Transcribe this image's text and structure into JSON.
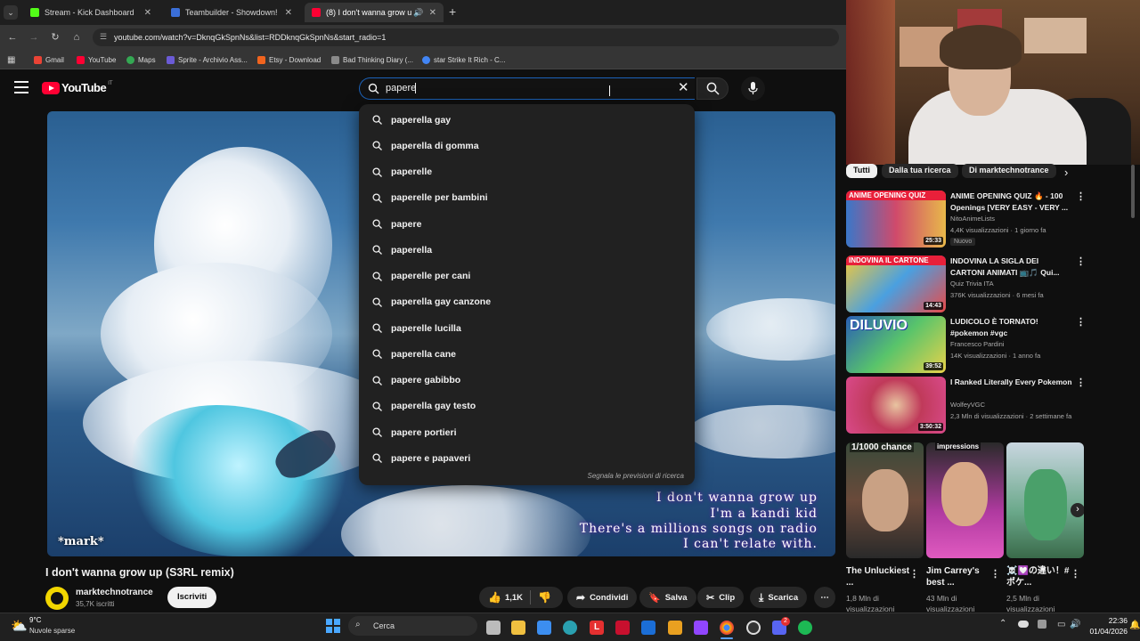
{
  "browser": {
    "tabs": [
      {
        "title": "Stream - Kick Dashboard",
        "favicon_color": "#53fc18",
        "active": false
      },
      {
        "title": "Teambuilder - Showdown!",
        "favicon_color": "#3b6fd8",
        "active": false
      },
      {
        "title": "(8) I don't wanna grow up (",
        "favicon_color": "#ff0033",
        "active": true
      }
    ],
    "new_tab_icon": "plus-icon",
    "url": "youtube.com/watch?v=DknqGkSpnNs&list=RDDknqGkSpnNs&start_radio=1",
    "bookmarks": [
      {
        "label": "Gmail",
        "color": "#ea4335"
      },
      {
        "label": "YouTube",
        "color": "#ff0033"
      },
      {
        "label": "Maps",
        "color": "#34a853"
      },
      {
        "label": "Sprite - Archivio Ass...",
        "color": "#6b5bd6"
      },
      {
        "label": "Etsy - Download",
        "color": "#f1641e"
      },
      {
        "label": "Bad Thinking Diary (...",
        "color": "#8a8a8a"
      },
      {
        "label": "star Strike It Rich - C...",
        "color": "#4285f4"
      }
    ]
  },
  "youtube": {
    "logo_text": "YouTube",
    "logo_region": "IT",
    "search_query": "papere",
    "suggestions": [
      "paperella gay",
      "paperella di gomma",
      "paperelle",
      "paperelle per bambini",
      "papere",
      "paperella",
      "paperelle per cani",
      "paperella gay canzone",
      "paperelle lucilla",
      "paperella cane",
      "papere gabibbo",
      "paperella gay testo",
      "papere portieri",
      "papere e papaveri"
    ],
    "report_text": "Segnala le previsioni di ricerca",
    "video": {
      "watermark": "*mark*",
      "lyrics": [
        "I don't wanna grow up",
        "I'm a kandi kid",
        "There's a millions songs on radio",
        "I can't relate with."
      ],
      "title": "I don't wanna grow up (S3RL remix)",
      "channel": "marktechnotrance",
      "subscribers": "35,7K iscritti",
      "subscribe_label": "Iscriviti",
      "likes": "1,1K",
      "share_label": "Condividi",
      "save_label": "Salva",
      "clip_label": "Clip",
      "download_label": "Scarica"
    },
    "chips": [
      "Tutti",
      "Dalla tua ricerca",
      "Di marktechnotrance"
    ],
    "related": [
      {
        "title": "ANIME OPENING QUIZ 🔥 - 100 Openings [VERY EASY - VERY ...",
        "channel": "NitoAnimeLists",
        "meta": "4,4K visualizzazioni · 1 giorno fa",
        "badge": "Nuovo",
        "duration": "25:33",
        "thumb_text": "ANIME OPENING QUIZ"
      },
      {
        "title": "INDOVINA LA SIGLA DEI CARTONI ANIMATI 📺🎵 Qui...",
        "channel": "Quiz Trivia ITA",
        "meta": "376K visualizzazioni · 6 mesi fa",
        "badge": "",
        "duration": "14:43",
        "thumb_text": "INDOVINA IL CARTONE"
      },
      {
        "title": "LUDICOLO È TORNATO! #pokemon #vgc",
        "channel": "Francesco Pardini",
        "meta": "14K visualizzazioni · 1 anno fa",
        "badge": "",
        "duration": "39:52",
        "thumb_text": "DILUVIO"
      },
      {
        "title": "I Ranked Literally Every Pokemon",
        "channel": "WolfeyVGC",
        "meta": "2,3 Mln di visualizzazioni · 2 settimane fa",
        "badge": "",
        "duration": "3:50:32",
        "thumb_text": ""
      }
    ],
    "shorts": [
      {
        "title": "The Unluckiest ...",
        "views": "1,8 Mln di visualizzazioni",
        "thumb_text": "1/1000 chance"
      },
      {
        "title": "Jim Carrey's best ...",
        "views": "43 Mln di visualizzazioni",
        "thumb_text": "impressions"
      },
      {
        "title": "☠️💟の違い！#ポケ...",
        "views": "2,5 Mln di visualizzazioni",
        "thumb_text": ""
      }
    ]
  },
  "taskbar": {
    "weather_temp": "9°C",
    "weather_desc": "Nuvole sparse",
    "search_label": "Cerca",
    "time": "22:36",
    "date": "01/04/2026",
    "discord_badge": "2"
  }
}
